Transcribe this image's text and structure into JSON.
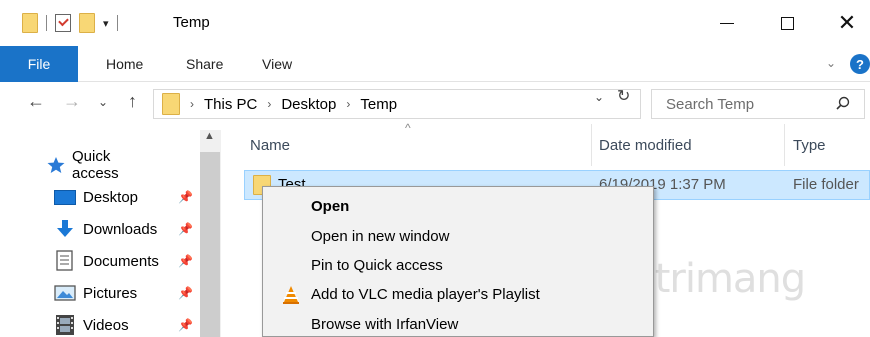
{
  "window": {
    "title": "Temp"
  },
  "ribbon": {
    "tabs": [
      "File",
      "Home",
      "Share",
      "View"
    ],
    "help": "?"
  },
  "address": {
    "crumbs": [
      "This PC",
      "Desktop",
      "Temp"
    ],
    "search_placeholder": "Search Temp"
  },
  "nav_pane": {
    "quick_access": "Quick access",
    "items": [
      {
        "label": "Desktop",
        "icon": "desktop-icon"
      },
      {
        "label": "Downloads",
        "icon": "downloads-icon"
      },
      {
        "label": "Documents",
        "icon": "documents-icon"
      },
      {
        "label": "Pictures",
        "icon": "pictures-icon"
      },
      {
        "label": "Videos",
        "icon": "videos-icon"
      }
    ]
  },
  "columns": {
    "name": "Name",
    "date": "Date modified",
    "type": "Type"
  },
  "files": [
    {
      "name": "Test",
      "date": "6/19/2019 1:37 PM",
      "type": "File folder"
    }
  ],
  "context_menu": {
    "items": [
      "Open",
      "Open in new window",
      "Pin to Quick access",
      "Add to VLC media player's Playlist",
      "Browse with IrfanView"
    ]
  },
  "watermark": "Quantrimang",
  "colors": {
    "accent": "#1a73c8",
    "selection": "#cce8ff",
    "folder": "#f8d775",
    "vlc": "#f08a00"
  }
}
